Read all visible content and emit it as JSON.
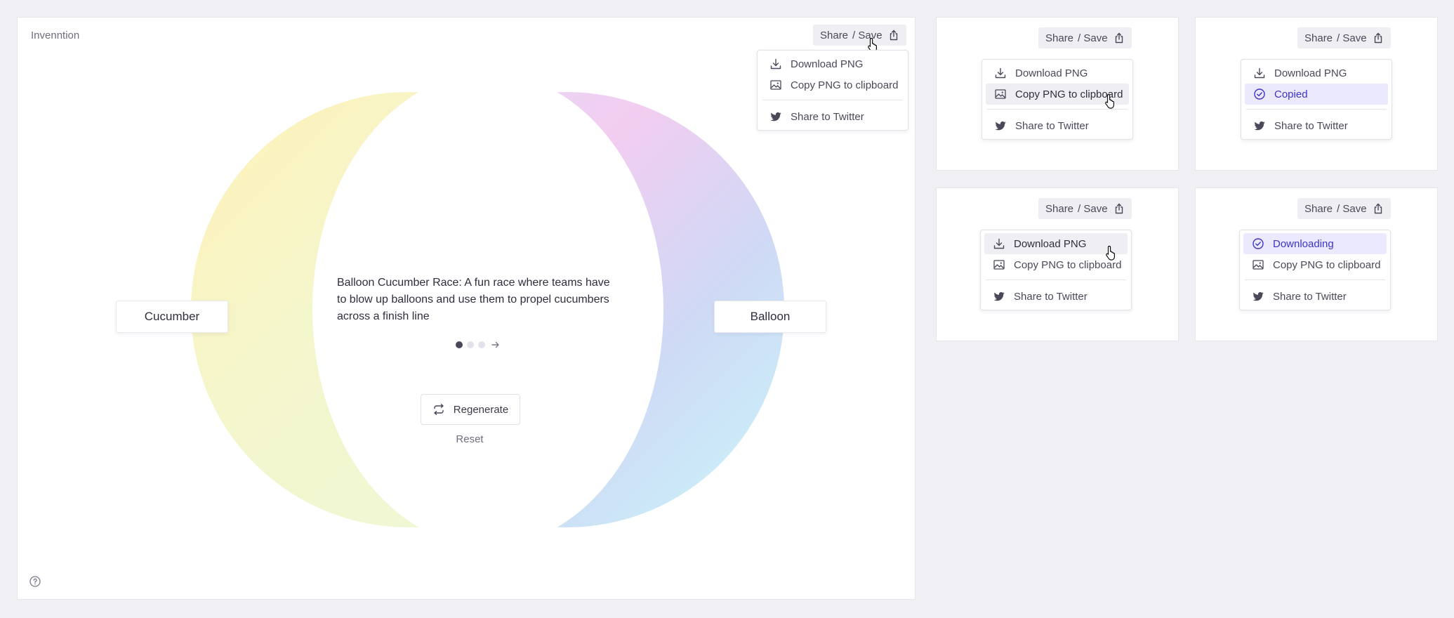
{
  "app": {
    "title": "Invenntion"
  },
  "share": {
    "share_label": "Share",
    "save_label": "/ Save"
  },
  "menu": {
    "download_png": "Download PNG",
    "copy_png": "Copy PNG to clipboard",
    "share_twitter": "Share to Twitter",
    "copied": "Copied",
    "downloading": "Downloading"
  },
  "venn": {
    "left_set": "Cucumber",
    "right_set": "Balloon",
    "idea": "Balloon Cucumber Race: A fun race where teams have to blow up balloons and use them to propel cucumbers across a finish line",
    "page_count": 3,
    "current_page": 1
  },
  "actions": {
    "regenerate": "Regenerate",
    "reset": "Reset"
  },
  "colors": {
    "accent": "#3d33c7",
    "active_bg": "#ebe9fd",
    "left_circle": "#fff1b8",
    "right_circle_pink": "#f3cdf1",
    "right_circle_cyan": "#c9f6fa"
  },
  "icons": [
    "share-icon",
    "download-icon",
    "image-icon",
    "twitter-icon",
    "check-circle-icon",
    "pointer-cursor-icon",
    "arrow-right-icon",
    "regenerate-icon",
    "help-icon"
  ]
}
